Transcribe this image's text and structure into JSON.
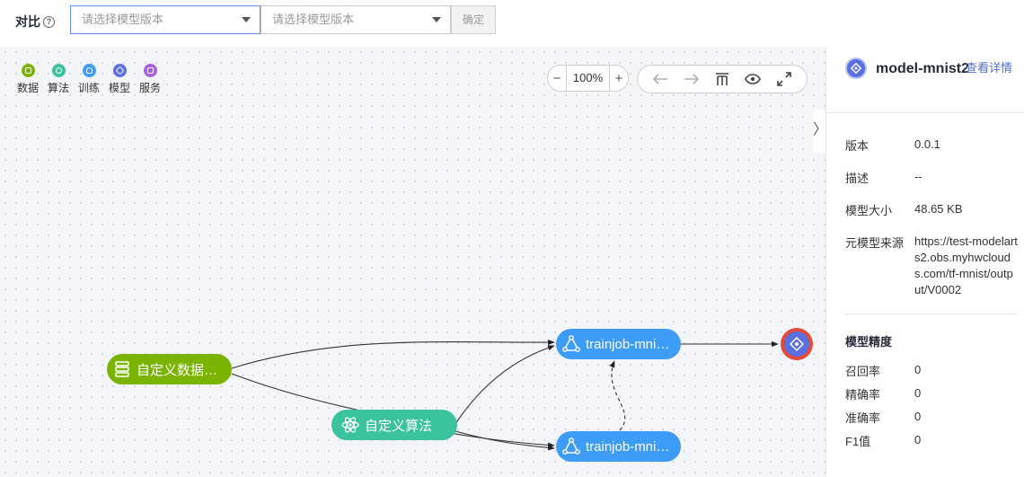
{
  "compare": {
    "label": "对比",
    "help_icon": "question-circle-icon",
    "select1_placeholder": "请选择模型版本",
    "select2_placeholder": "请选择模型版本",
    "confirm_label": "确定"
  },
  "legend": [
    {
      "label": "数据",
      "icon": "data-icon",
      "color": "#7ab400"
    },
    {
      "label": "算法",
      "icon": "algorithm-icon",
      "color": "#3ac39e"
    },
    {
      "label": "训练",
      "icon": "training-icon",
      "color": "#3d9cf5"
    },
    {
      "label": "模型",
      "icon": "model-icon",
      "color": "#5b6fe0"
    },
    {
      "label": "服务",
      "icon": "service-icon",
      "color": "#a660e0"
    }
  ],
  "toolbar": {
    "zoom_out": "−",
    "zoom_value": "100%",
    "zoom_in": "+",
    "icons": [
      "undo-icon",
      "redo-icon",
      "layout-icon",
      "eye-icon",
      "fullscreen-icon"
    ]
  },
  "graph": {
    "nodes": {
      "data": {
        "label": "自定义数据…",
        "type": "data"
      },
      "algo": {
        "label": "自定义算法",
        "type": "algorithm"
      },
      "train1": {
        "label": "trainjob-mni…",
        "type": "training"
      },
      "train2": {
        "label": "trainjob-mni…",
        "type": "training"
      },
      "model": {
        "type": "model"
      }
    }
  },
  "panel": {
    "title": "model-mnist2",
    "detail_link": "查看详情",
    "fields": [
      {
        "key": "版本",
        "value": "0.0.1"
      },
      {
        "key": "描述",
        "value": "--"
      },
      {
        "key": "模型大小",
        "value": "48.65 KB"
      },
      {
        "key": "元模型来源",
        "value": "https://test-modelarts2.obs.myhwclouds.com/tf-mnist/output/V0002"
      }
    ],
    "accuracy_title": "模型精度",
    "metrics": [
      {
        "key": "召回率",
        "value": "0"
      },
      {
        "key": "精确率",
        "value": "0"
      },
      {
        "key": "准确率",
        "value": "0"
      },
      {
        "key": "F1值",
        "value": "0"
      }
    ],
    "collapse_glyph": "〉"
  }
}
